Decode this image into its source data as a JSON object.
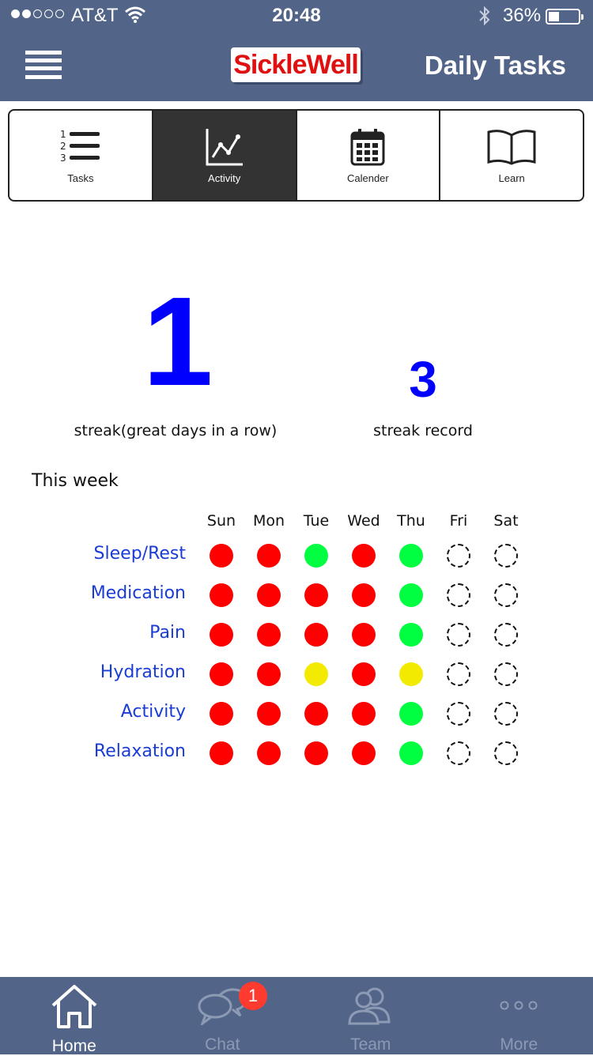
{
  "status_bar": {
    "carrier": "AT&T",
    "time": "20:48",
    "battery_percent": "36%",
    "battery_level": 0.36,
    "signal_bars": 2,
    "signal_total": 5
  },
  "header": {
    "logo_text": "SickleWell",
    "title": "Daily Tasks",
    "logo_color": "#e01010"
  },
  "tabs": [
    {
      "label": "Tasks",
      "icon": "numbered-list-icon",
      "active": false
    },
    {
      "label": "Activity",
      "icon": "line-chart-icon",
      "active": true
    },
    {
      "label": "Calender",
      "icon": "calendar-icon",
      "active": false
    },
    {
      "label": "Learn",
      "icon": "open-book-icon",
      "active": false
    }
  ],
  "streak": {
    "value": "1",
    "label": "streak(great days in a row)"
  },
  "record": {
    "value": "3",
    "label": "streak record"
  },
  "week": {
    "title": "This week",
    "days": [
      "Sun",
      "Mon",
      "Tue",
      "Wed",
      "Thu",
      "Fri",
      "Sat"
    ],
    "rows": [
      {
        "label": "Sleep/Rest",
        "status": [
          "red",
          "red",
          "green",
          "red",
          "green",
          "empty",
          "empty"
        ]
      },
      {
        "label": "Medication",
        "status": [
          "red",
          "red",
          "red",
          "red",
          "green",
          "empty",
          "empty"
        ]
      },
      {
        "label": "Pain",
        "status": [
          "red",
          "red",
          "red",
          "red",
          "green",
          "empty",
          "empty"
        ]
      },
      {
        "label": "Hydration",
        "status": [
          "red",
          "red",
          "yellow",
          "red",
          "yellow",
          "empty",
          "empty"
        ]
      },
      {
        "label": "Activity",
        "status": [
          "red",
          "red",
          "red",
          "red",
          "green",
          "empty",
          "empty"
        ]
      },
      {
        "label": "Relaxation",
        "status": [
          "red",
          "red",
          "red",
          "red",
          "green",
          "empty",
          "empty"
        ]
      }
    ],
    "colors": {
      "red": "#ff0000",
      "green": "#00ff40",
      "yellow": "#f2ea00"
    }
  },
  "bottom_nav": {
    "items": [
      {
        "label": "Home",
        "icon": "home-icon",
        "active": true
      },
      {
        "label": "Chat",
        "icon": "chat-bubbles-icon",
        "active": false
      },
      {
        "label": "Team",
        "icon": "team-icon",
        "active": false
      },
      {
        "label": "More",
        "icon": "more-dots-icon",
        "active": false
      }
    ],
    "chat_badge": "1"
  },
  "colors": {
    "bar_bg": "#526589",
    "active_tab_bg": "#333333",
    "accent_blue": "#0000ff",
    "row_label_blue": "#1a3cd6"
  }
}
